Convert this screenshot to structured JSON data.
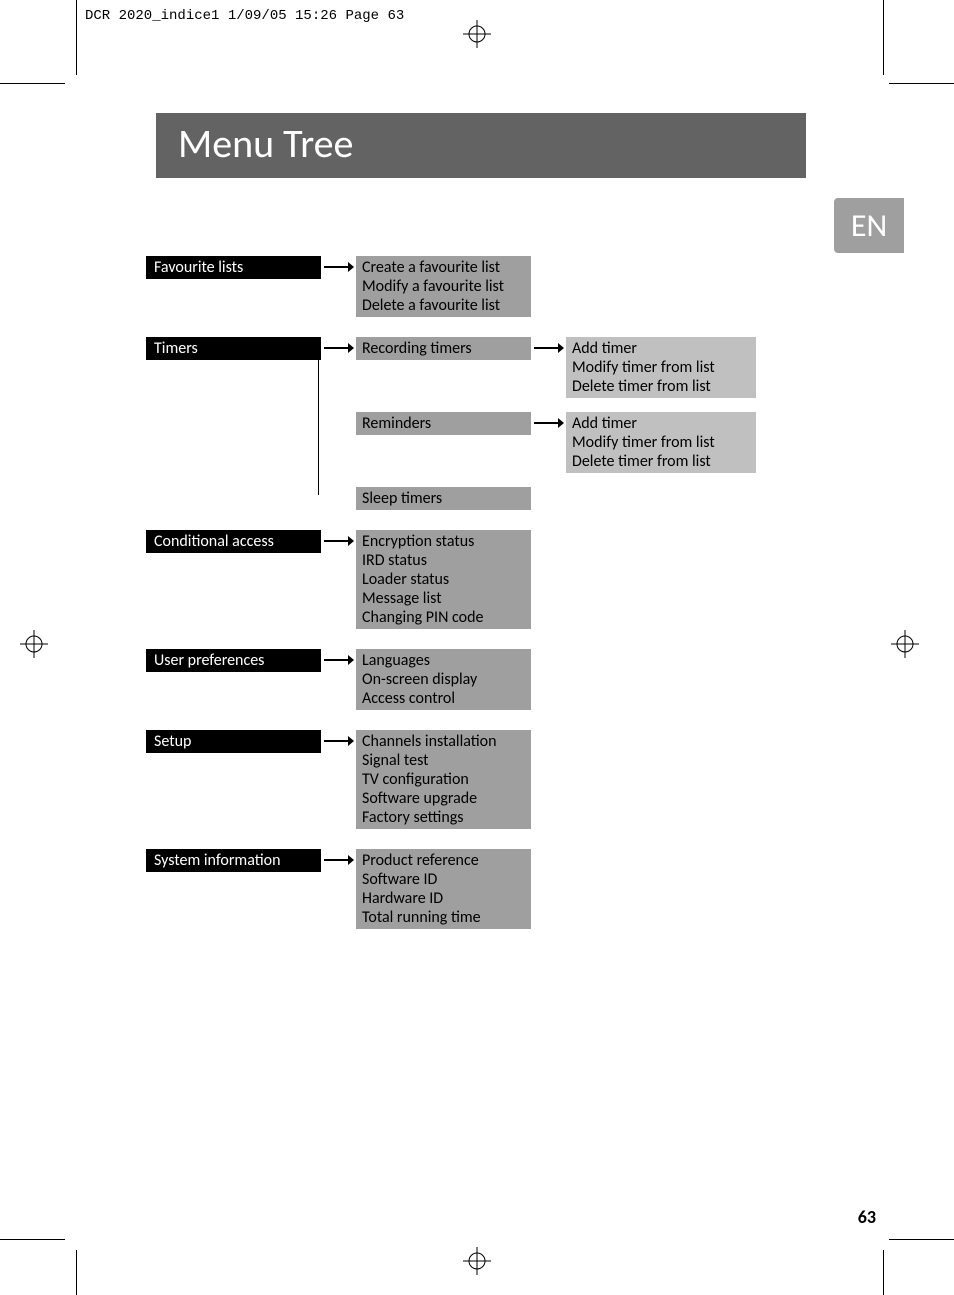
{
  "slug": "DCR 2020_indice1  1/09/05  15:26  Page 63",
  "title": "Menu Tree",
  "language_tab": "EN",
  "page_number": "63",
  "menu": {
    "favourite_lists": {
      "label": "Favourite lists",
      "items": [
        "Create a favourite list",
        "Modify a favourite list",
        "Delete a favourite list"
      ]
    },
    "timers": {
      "label": "Timers",
      "recording_timers": {
        "label": "Recording timers",
        "items": [
          "Add timer",
          "Modify timer from list",
          "Delete timer from list"
        ]
      },
      "reminders": {
        "label": "Reminders",
        "items": [
          "Add timer",
          "Modify timer from list",
          "Delete timer from list"
        ]
      },
      "sleep_timers": {
        "label": "Sleep timers"
      }
    },
    "conditional_access": {
      "label": "Conditional access",
      "items": [
        "Encryption status",
        "IRD status",
        "Loader status",
        "Message list",
        "Changing PIN code"
      ]
    },
    "user_preferences": {
      "label": "User preferences",
      "items": [
        "Languages",
        "On-screen display",
        "Access control"
      ]
    },
    "setup": {
      "label": "Setup",
      "items": [
        "Channels installation",
        "Signal test",
        "TV configuration",
        "Software upgrade",
        "Factory settings"
      ]
    },
    "system_information": {
      "label": "System information",
      "items": [
        "Product reference",
        "Software ID",
        "Hardware ID",
        "Total running time"
      ]
    }
  }
}
